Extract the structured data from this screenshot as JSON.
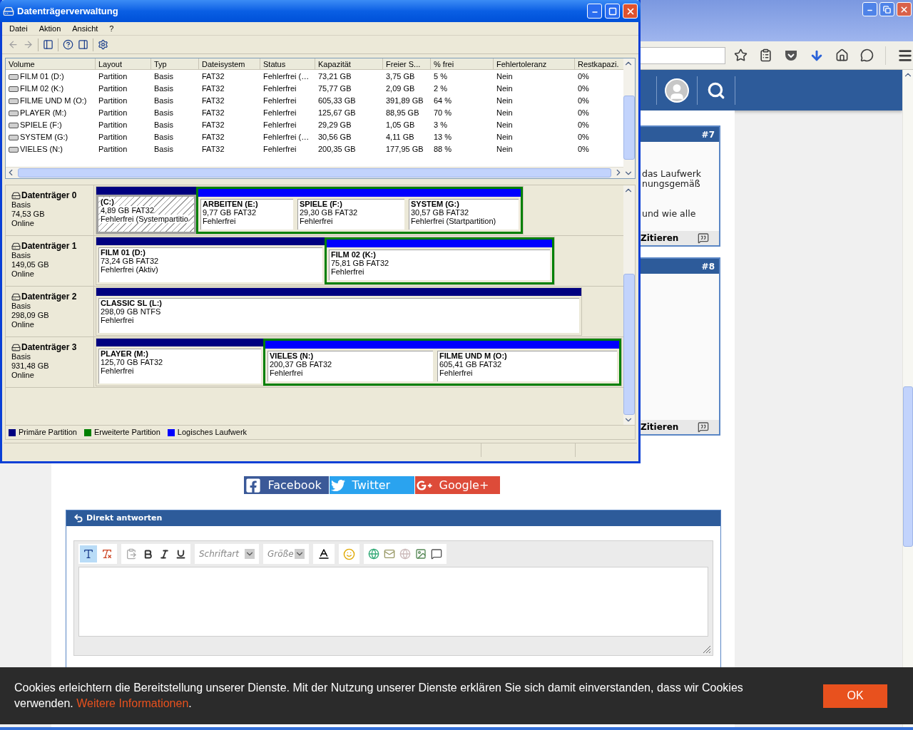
{
  "disk_window": {
    "title": "Datenträgerverwaltung",
    "menu": [
      "Datei",
      "Aktion",
      "Ansicht",
      "?"
    ],
    "table": {
      "columns": [
        "Volume",
        "Layout",
        "Typ",
        "Dateisystem",
        "Status",
        "Kapazität",
        "Freier S...",
        "% frei",
        "Fehlertoleranz",
        "Restkapazi."
      ],
      "rows": [
        [
          "FILM 01 (D:)",
          "Partition",
          "Basis",
          "FAT32",
          "Fehlerfrei (…",
          "73,21 GB",
          "3,75 GB",
          "5 %",
          "Nein",
          "0%"
        ],
        [
          "FILM 02 (K:)",
          "Partition",
          "Basis",
          "FAT32",
          "Fehlerfrei",
          "75,77 GB",
          "2,09 GB",
          "2 %",
          "Nein",
          "0%"
        ],
        [
          "FILME UND M (O:)",
          "Partition",
          "Basis",
          "FAT32",
          "Fehlerfrei",
          "605,33 GB",
          "391,89 GB",
          "64 %",
          "Nein",
          "0%"
        ],
        [
          "PLAYER (M:)",
          "Partition",
          "Basis",
          "FAT32",
          "Fehlerfrei",
          "125,67 GB",
          "88,95 GB",
          "70 %",
          "Nein",
          "0%"
        ],
        [
          "SPIELE (F:)",
          "Partition",
          "Basis",
          "FAT32",
          "Fehlerfrei",
          "29,29 GB",
          "1,05 GB",
          "3 %",
          "Nein",
          "0%"
        ],
        [
          "SYSTEM (G:)",
          "Partition",
          "Basis",
          "FAT32",
          "Fehlerfrei (…",
          "30,56 GB",
          "4,11 GB",
          "13 %",
          "Nein",
          "0%"
        ],
        [
          "VIELES (N:)",
          "Partition",
          "Basis",
          "FAT32",
          "Fehlerfrei",
          "200,35 GB",
          "177,95 GB",
          "88 %",
          "Nein",
          "0%"
        ]
      ]
    },
    "disks": [
      {
        "name": "Datenträger 0",
        "type": "Basis",
        "size": "74,53 GB",
        "status": "Online",
        "partitions": [
          {
            "kind": "primary",
            "selected": true,
            "name": "(C:)",
            "size_fs": "4,89 GB FAT32",
            "status": "Fehlerfrei (Systempartitio"
          },
          {
            "kind": "logical",
            "selected": false,
            "name": "ARBEITEN  (E:)",
            "size_fs": "9,77 GB FAT32",
            "status": "Fehlerfrei"
          },
          {
            "kind": "logical",
            "selected": false,
            "name": "SPIELE  (F:)",
            "size_fs": "29,30 GB FAT32",
            "status": "Fehlerfrei"
          },
          {
            "kind": "logical",
            "selected": false,
            "name": "SYSTEM  (G:)",
            "size_fs": "30,57 GB FAT32",
            "status": "Fehlerfrei (Startpartition)"
          }
        ]
      },
      {
        "name": "Datenträger 1",
        "type": "Basis",
        "size": "149,05 GB",
        "status": "Online",
        "partitions": [
          {
            "kind": "primary",
            "selected": false,
            "name": "FILM 01  (D:)",
            "size_fs": "73,24 GB FAT32",
            "status": "Fehlerfrei (Aktiv)"
          },
          {
            "kind": "logical",
            "selected": false,
            "name": "FILM 02  (K:)",
            "size_fs": "75,81 GB FAT32",
            "status": "Fehlerfrei"
          }
        ]
      },
      {
        "name": "Datenträger 2",
        "type": "Basis",
        "size": "298,09 GB",
        "status": "Online",
        "partitions": [
          {
            "kind": "primary",
            "selected": false,
            "name": "CLASSIC SL  (L:)",
            "size_fs": "298,09 GB NTFS",
            "status": "Fehlerfrei"
          }
        ]
      },
      {
        "name": "Datenträger 3",
        "type": "Basis",
        "size": "931,48 GB",
        "status": "Online",
        "partitions": [
          {
            "kind": "primary",
            "selected": false,
            "name": "PLAYER  (M:)",
            "size_fs": "125,70 GB FAT32",
            "status": "Fehlerfrei"
          },
          {
            "kind": "logical",
            "selected": false,
            "name": "VIELES  (N:)",
            "size_fs": "200,37 GB FAT32",
            "status": "Fehlerfrei"
          },
          {
            "kind": "logical",
            "selected": false,
            "name": "FILME UND M  (O:)",
            "size_fs": "605,41 GB FAT32",
            "status": "Fehlerfrei"
          }
        ]
      }
    ],
    "legend": [
      {
        "label": "Primäre Partition",
        "color": "#000080"
      },
      {
        "label": "Erweiterte Partition",
        "color": "#008000"
      },
      {
        "label": "Logisches Laufwerk",
        "color": "#0000ff"
      }
    ]
  },
  "posts": [
    {
      "number": "#7",
      "paragraphs": [
        [
          "das Laufwerk",
          "nungsgemäß"
        ],
        [
          "und wie alle"
        ]
      ],
      "action": "Zitieren"
    },
    {
      "number": "#8",
      "action": "Zitieren"
    }
  ],
  "share": [
    {
      "label": "Facebook",
      "color": "#3b5998"
    },
    {
      "label": "Twitter",
      "color": "#2aa3ef"
    },
    {
      "label": "Google+",
      "color": "#dd4b39"
    }
  ],
  "editor": {
    "title": "Direkt antworten",
    "font_select": "Schriftart",
    "size_select": "Größe"
  },
  "cookie": {
    "text": "Cookies erleichtern die Bereitstellung unserer Dienste. Mit der Nutzung unserer Dienste erklären Sie sich damit einverstanden, dass wir Cookies verwenden.",
    "link": "Weitere Informationen",
    "after": ".",
    "button": "OK"
  }
}
